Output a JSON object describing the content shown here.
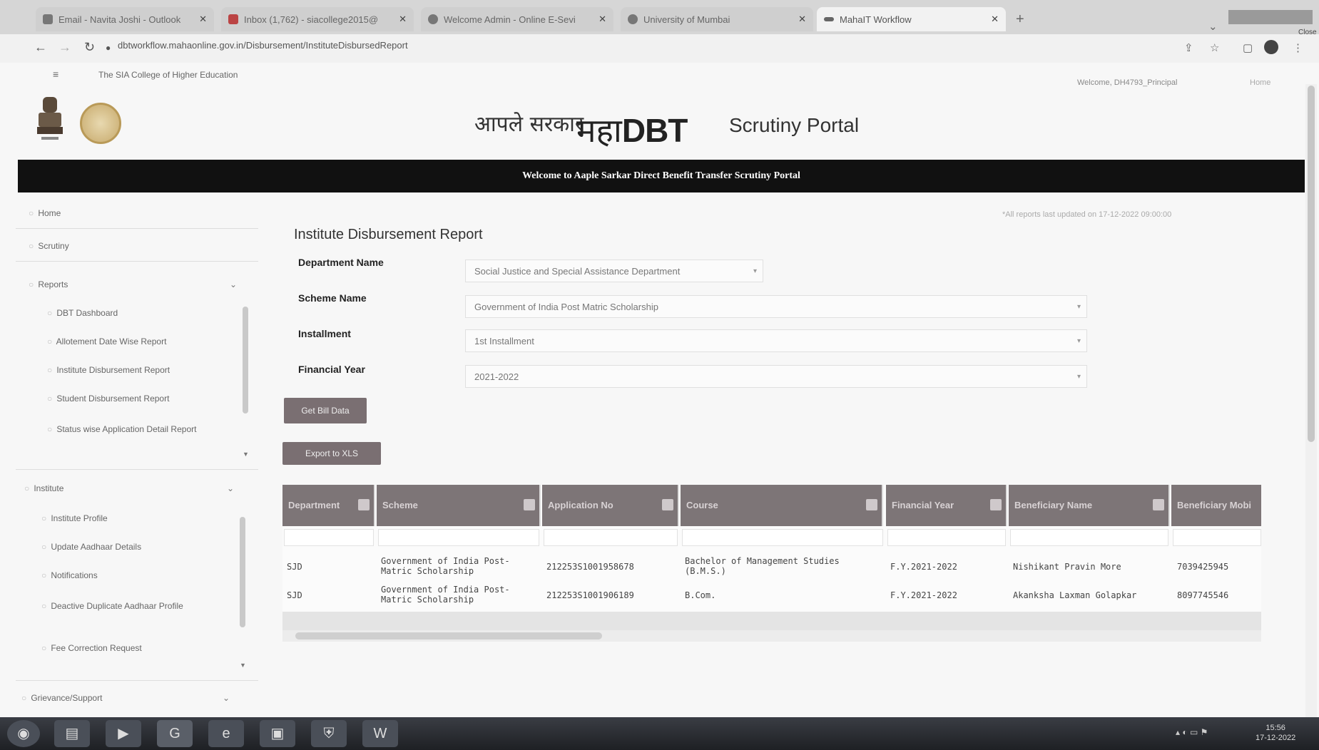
{
  "browser": {
    "tabs": [
      {
        "label": "Email - Navita Joshi - Outlook",
        "active": false
      },
      {
        "label": "Inbox (1,762) - siacollege2015@",
        "active": false
      },
      {
        "label": "Welcome Admin - Online E-Sevi",
        "active": false
      },
      {
        "label": "University of Mumbai",
        "active": false
      },
      {
        "label": "MahaIT Workflow",
        "active": true
      }
    ],
    "new_tab": "+",
    "url": "dbtworkflow.mahaonline.gov.in/Disbursement/InstituteDisbursedReport",
    "close_tooltip": "Close"
  },
  "page": {
    "institute_name": "The SIA College of Higher Education",
    "welcome_user": "Welcome, DH4793_Principal",
    "logout": "Home",
    "brand_hindi": "आपले सरकार",
    "brand_maha": "महा",
    "brand_dbt": "DBT",
    "brand_portal": "Scrutiny Portal",
    "banner": "Welcome to Aaple Sarkar Direct Benefit Transfer Scrutiny Portal",
    "updated_note": "*All reports last updated on 17-12-2022 09:00:00"
  },
  "sidebar": {
    "home": "Home",
    "scrutiny": "Scrutiny",
    "reports": "Reports",
    "report_items": [
      "DBT Dashboard",
      "Allotement Date Wise Report",
      "Institute Disbursement Report",
      "Student Disbursement Report",
      "Status wise Application Detail Report"
    ],
    "institute": "Institute",
    "institute_items": [
      "Institute Profile",
      "Update Aadhaar Details",
      "Notifications",
      "Deactive Duplicate Aadhaar Profile",
      "Fee Correction Request"
    ],
    "grievance": "Grievance/Support"
  },
  "report": {
    "title": "Institute Disbursement Report",
    "department_label": "Department Name",
    "department_value": "Social Justice and Special Assistance Department",
    "scheme_label": "Scheme Name",
    "scheme_value": "Government of India Post Matric Scholarship",
    "installment_label": "Installment",
    "installment_value": "1st Installment",
    "fy_label": "Financial Year",
    "fy_value": "2021-2022",
    "get_bill_btn": "Get Bill Data",
    "export_btn": "Export to XLS"
  },
  "table": {
    "headers": [
      "Department",
      "Scheme",
      "Application No",
      "Course",
      "Financial Year",
      "Beneficiary Name",
      "Beneficiary Mobi"
    ],
    "rows": [
      [
        "SJD",
        "Government of India Post-Matric Scholarship",
        "212253S1001958678",
        "Bachelor of Management Studies (B.M.S.)",
        "F.Y.2021-2022",
        "Nishikant Pravin More",
        "7039425945"
      ],
      [
        "SJD",
        "Government of India Post-Matric Scholarship",
        "212253S1001906189",
        "B.Com.",
        "F.Y.2021-2022",
        "Akanksha Laxman Golapkar",
        "8097745546"
      ]
    ]
  },
  "taskbar": {
    "time": "15:56",
    "date": "17-12-2022"
  }
}
